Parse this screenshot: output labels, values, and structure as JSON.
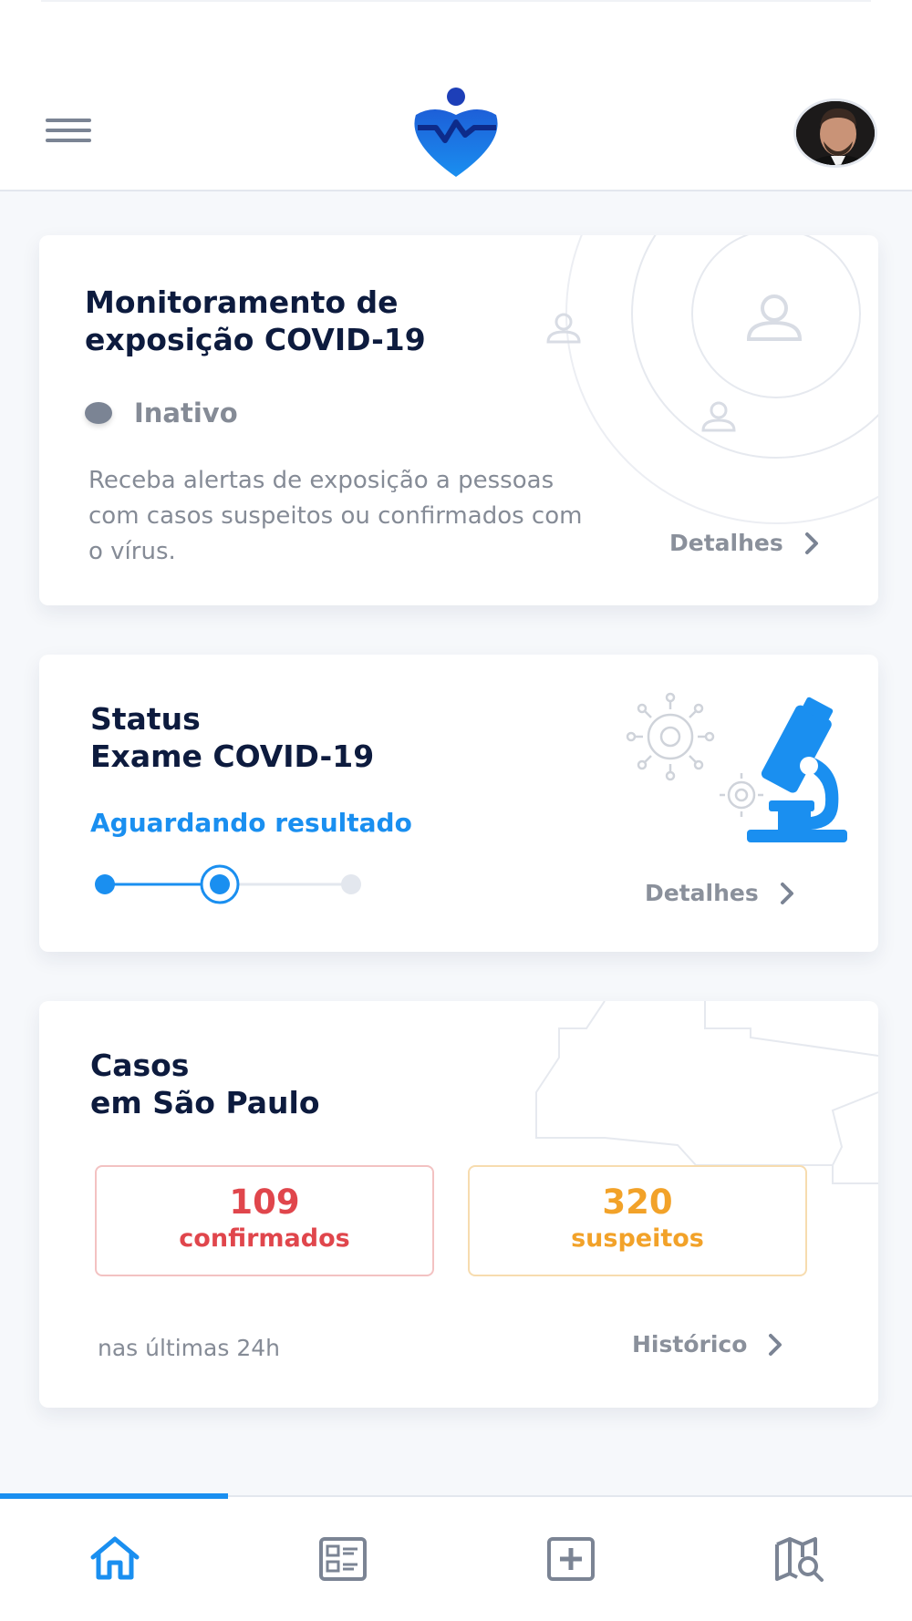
{
  "header": {
    "menu_icon": "hamburger-menu-icon",
    "logo_icon": "heart-shield-logo",
    "avatar_icon": "user-avatar"
  },
  "exposure_card": {
    "title": "Monitoramento de\nexposição COVID-19",
    "status": "Inativo",
    "description": "Receba alertas de exposição a pessoas com casos suspeitos ou confirmados com o vírus.",
    "details_label": "Detalhes"
  },
  "exam_card": {
    "title": "Status\nExame COVID-19",
    "status": "Aguardando resultado",
    "progress_current_step": 2,
    "progress_total_steps": 3,
    "details_label": "Detalhes"
  },
  "cases_card": {
    "title": "Casos\nem São Paulo",
    "confirmed_value": "109",
    "confirmed_label": "confirmados",
    "suspected_value": "320",
    "suspected_label": "suspeitos",
    "period_label": "nas últimas 24h",
    "history_label": "Histórico"
  },
  "bottom_nav": {
    "items": [
      {
        "icon": "home-icon",
        "active": true
      },
      {
        "icon": "list-icon",
        "active": false
      },
      {
        "icon": "medical-plus-icon",
        "active": false
      },
      {
        "icon": "map-search-icon",
        "active": false
      }
    ]
  },
  "colors": {
    "accent": "#1a8ff0",
    "brand_dark": "#0d1b3e",
    "confirmed": "#e0464c",
    "suspected": "#f2a229",
    "muted": "#858b96"
  }
}
